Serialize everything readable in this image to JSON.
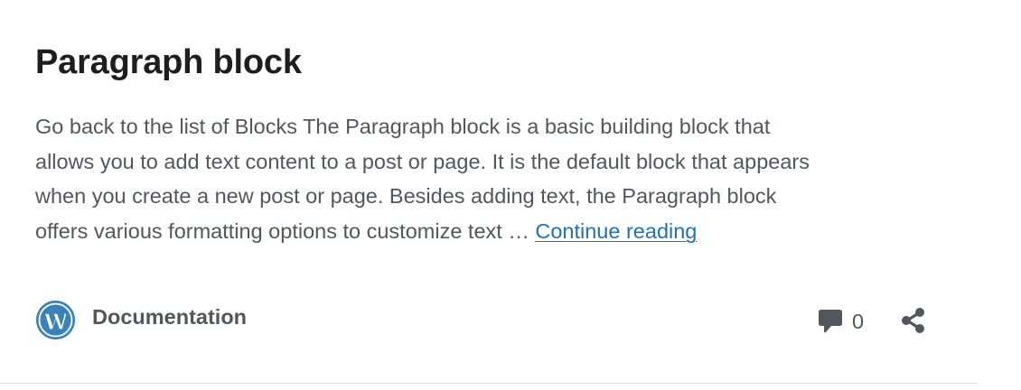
{
  "post": {
    "title": "Paragraph block",
    "excerpt_lines": [
      "Go back to the list of Blocks The Paragraph block is a basic building block that",
      "allows you to add text content to a post or page. It is the default block that appears",
      "when you create a new post or page. Besides adding text, the Paragraph block",
      "offers various formatting options to customize text … "
    ],
    "continue_label": "Continue reading"
  },
  "footer": {
    "category_icon": "wordpress-logo-icon",
    "category_label": "Documentation",
    "comment_icon": "comment-bubble-icon",
    "comment_count": "0",
    "share_icon": "share-icon"
  },
  "colors": {
    "title": "#1e1e1e",
    "text": "#50575e",
    "link": "#2271b1",
    "logo": "#3b82b9",
    "divider": "#dcdcde"
  }
}
